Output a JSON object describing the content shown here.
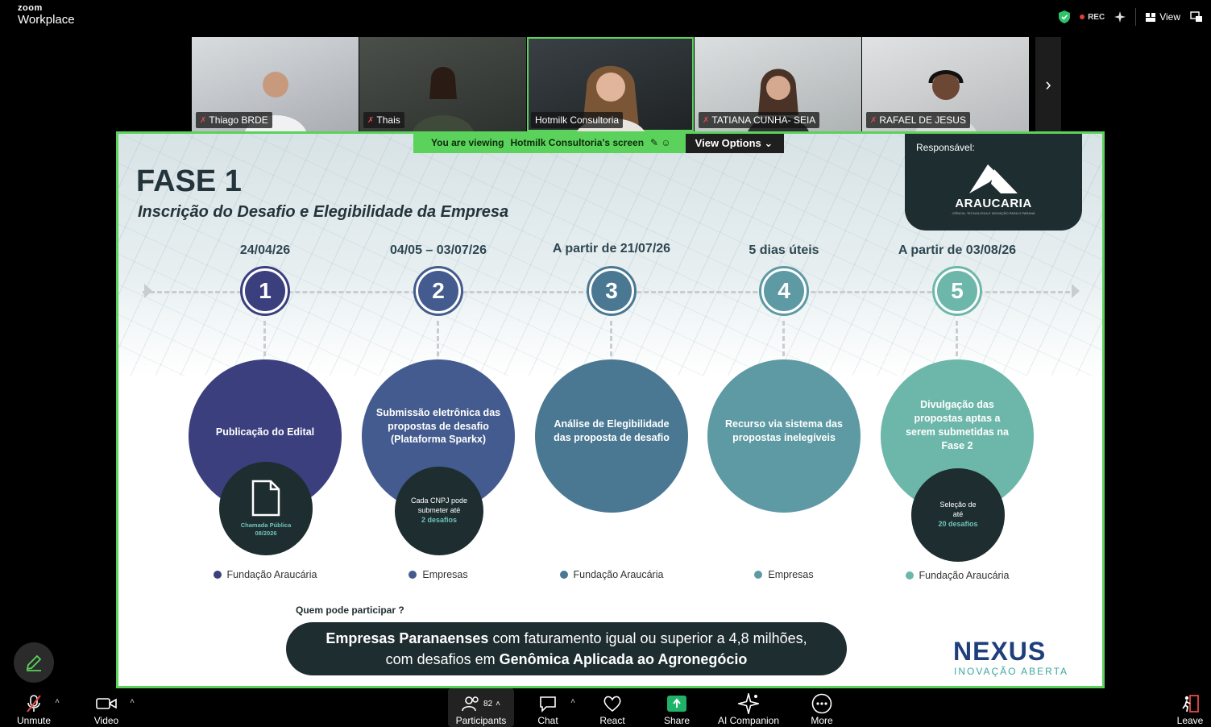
{
  "app": {
    "logo_top": "zoom",
    "logo_bottom": "Workplace",
    "rec_label": "REC",
    "view_label": "View"
  },
  "participants": [
    {
      "name": "Thiago BRDE",
      "muted": true
    },
    {
      "name": "Thais",
      "muted": true
    },
    {
      "name": "Hotmilk Consultoria",
      "muted": false
    },
    {
      "name": "TATIANA CUNHA- SEIA",
      "muted": true
    },
    {
      "name": "RAFAEL DE JESUS",
      "muted": true
    }
  ],
  "share_banner": {
    "prefix": "You are viewing",
    "name": "Hotmilk Consultoria's screen",
    "options": "View Options"
  },
  "slide": {
    "title": "FASE 1",
    "subtitle": "Inscrição do Desafio e Elegibilidade da Empresa",
    "responsavel": "Responsável:",
    "brand": "ARAUCARIA",
    "brand_tag": "CIÊNCIA, TECNOLOGIA E INOVAÇÃO PARA O PARANÁ",
    "steps": [
      {
        "num": "1",
        "date": "24/04/26",
        "text": "Publicação do Edital",
        "small_lines": [
          "Chamada Pública 08/2026"
        ],
        "small_hl": "",
        "who": "Fundação Araucária",
        "color": "#3b3f7e"
      },
      {
        "num": "2",
        "date": "04/05 – 03/07/26",
        "text": "Submissão eletrônica das propostas de desafio (Plataforma Sparkx)",
        "small_lines": [
          "Cada CNPJ pode submeter até"
        ],
        "small_hl": "2 desafios",
        "who": "Empresas",
        "color": "#435b8e"
      },
      {
        "num": "3",
        "date": "A partir de 21/07/26",
        "text": "Análise de Elegibilidade das proposta de desafio",
        "small_lines": [],
        "small_hl": "",
        "who": "Fundação Araucária",
        "color": "#4a7893"
      },
      {
        "num": "4",
        "date": "5 dias úteis",
        "text": "Recurso via sistema das propostas inelegíveis",
        "small_lines": [],
        "small_hl": "",
        "who": "Empresas",
        "color": "#5e9aa3"
      },
      {
        "num": "5",
        "date": "A partir de 03/08/26",
        "text": "Divulgação das propostas aptas a serem submetidas na Fase 2",
        "small_lines": [
          "Seleção de até"
        ],
        "small_hl": "20 desafios",
        "who": "Fundação Araucária",
        "color": "#6db7aa"
      }
    ],
    "question": "Quem pode participar ?",
    "pill_line1_bold": "Empresas Paranaenses",
    "pill_line1_rest": " com faturamento igual ou superior a 4,8 milhões,",
    "pill_line2_rest": "com desafios em ",
    "pill_line2_bold": "Genômica Aplicada ao Agronegócio",
    "nexus": "NEXUS",
    "nexus_sub": "INOVAÇÃO ABERTA"
  },
  "toolbar": {
    "unmute": "Unmute",
    "video": "Video",
    "participants": "Participants",
    "participants_count": "82",
    "chat": "Chat",
    "react": "React",
    "share": "Share",
    "ai": "AI Companion",
    "more": "More",
    "leave": "Leave"
  },
  "colors": {
    "accent_green": "#5bd25b",
    "dark_teal": "#1e2d30",
    "share_green": "#1fb36a"
  }
}
